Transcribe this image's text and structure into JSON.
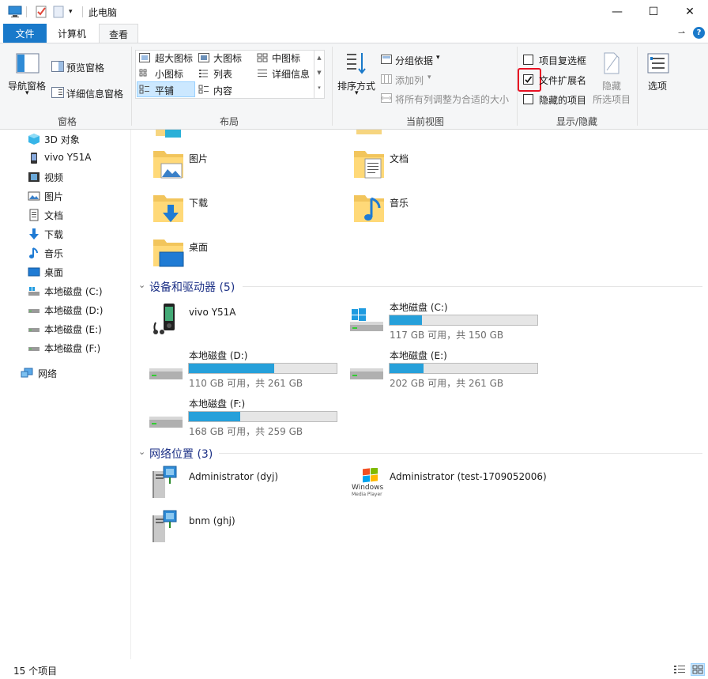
{
  "window": {
    "title": "此电脑",
    "minimize": "—",
    "maximize": "☐",
    "close": "✕"
  },
  "tabs": {
    "file": "文件",
    "computer": "计算机",
    "view": "查看"
  },
  "ribbon": {
    "pane": {
      "nav_pane": "导航窗格",
      "preview_pane": "预览窗格",
      "details_pane": "详细信息窗格",
      "label": "窗格"
    },
    "layout": {
      "extra_large": "超大图标",
      "large": "大图标",
      "medium": "中图标",
      "small": "小图标",
      "list": "列表",
      "details": "详细信息",
      "tiles": "平铺",
      "content": "内容",
      "label": "布局"
    },
    "current_view": {
      "sort_by": "排序方式",
      "group_by": "分组依据",
      "add_columns": "添加列",
      "size_all": "将所有列调整为合适的大小",
      "label": "当前视图"
    },
    "show_hide": {
      "item_checkboxes": "项目复选框",
      "file_extensions": "文件扩展名",
      "hidden_items": "隐藏的项目",
      "hide_selected_1": "隐藏",
      "hide_selected_2": "所选项目",
      "label": "显示/隐藏"
    },
    "options": "选项"
  },
  "nav": {
    "items": [
      {
        "label": "3D 对象"
      },
      {
        "label": "vivo Y51A"
      },
      {
        "label": "视频"
      },
      {
        "label": "图片"
      },
      {
        "label": "文档"
      },
      {
        "label": "下载"
      },
      {
        "label": "音乐"
      },
      {
        "label": "桌面"
      },
      {
        "label": "本地磁盘 (C:)"
      },
      {
        "label": "本地磁盘 (D:)"
      },
      {
        "label": "本地磁盘 (E:)"
      },
      {
        "label": "本地磁盘 (F:)"
      }
    ],
    "network": "网络"
  },
  "folders": [
    {
      "name": "图片"
    },
    {
      "name": "文档"
    },
    {
      "name": "下载"
    },
    {
      "name": "音乐"
    },
    {
      "name": "桌面"
    }
  ],
  "devices": {
    "header": "设备和驱动器 (5)",
    "phone": "vivo Y51A",
    "drives": [
      {
        "name": "本地磁盘 (C:)",
        "info": "117 GB 可用，共 150 GB",
        "used_pct": 22
      },
      {
        "name": "本地磁盘 (D:)",
        "info": "110 GB 可用，共 261 GB",
        "used_pct": 58
      },
      {
        "name": "本地磁盘 (E:)",
        "info": "202 GB 可用，共 261 GB",
        "used_pct": 23
      },
      {
        "name": "本地磁盘 (F:)",
        "info": "168 GB 可用，共 259 GB",
        "used_pct": 35
      }
    ]
  },
  "network_locations": {
    "header": "网络位置 (3)",
    "items": [
      {
        "name": "Administrator (dyj)"
      },
      {
        "name": "Administrator (test-1709052006)"
      },
      {
        "name": "bnm (ghj)"
      }
    ],
    "wmp_logo_1": "Windows",
    "wmp_logo_2": "Media Player"
  },
  "status": {
    "count": "15 个项目"
  },
  "colors": {
    "accent": "#1979ca",
    "drive_bar": "#26a0da",
    "highlight_box": "#e81123"
  }
}
